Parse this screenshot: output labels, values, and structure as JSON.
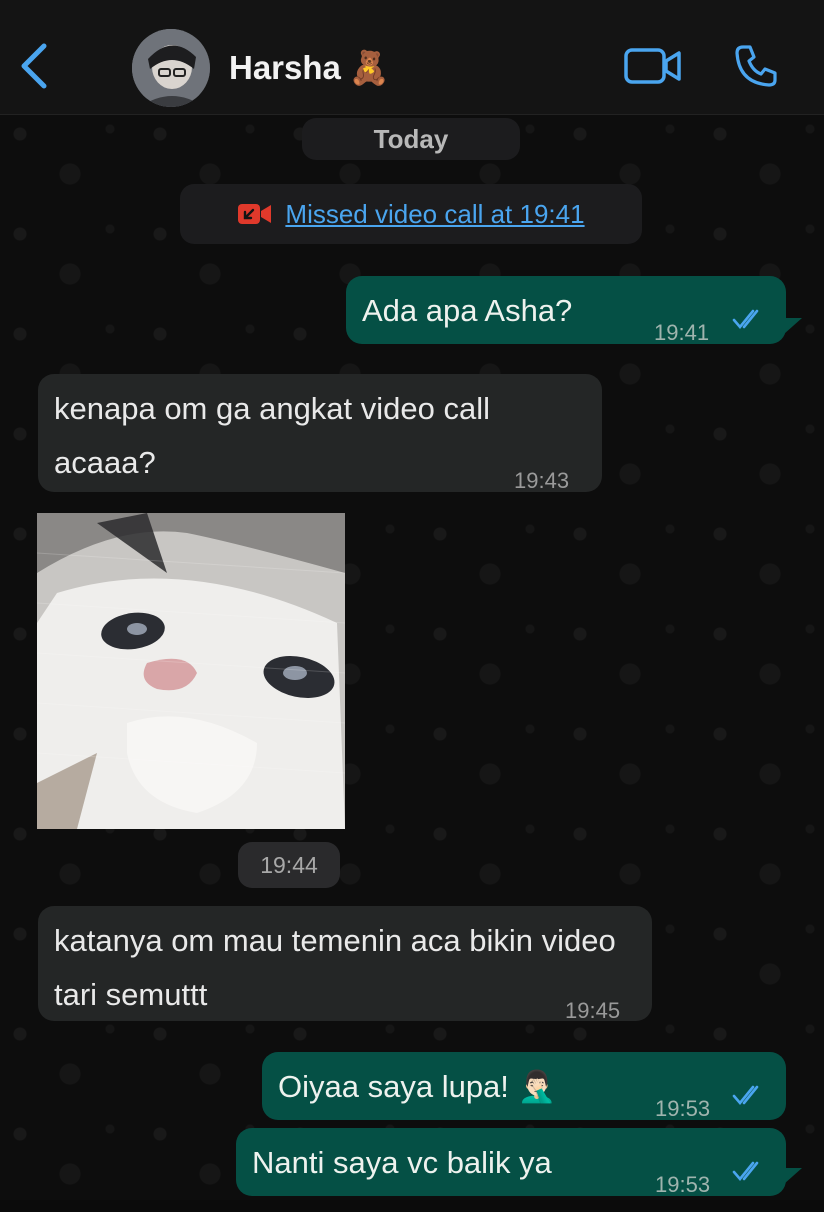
{
  "header": {
    "contact_name": "Harsha",
    "name_emoji": "🧸"
  },
  "date_divider": "Today",
  "missed_call": {
    "icon": "missed-video-call-icon",
    "text": "Missed video call at 19:41"
  },
  "messages": [
    {
      "direction": "outgoing",
      "text": "Ada apa Asha?",
      "time": "19:41",
      "status": "read"
    },
    {
      "direction": "incoming",
      "text": "kenapa om ga angkat video call acaaa?",
      "time": "19:43"
    },
    {
      "direction": "incoming",
      "type": "image",
      "image": "crying-cat-photo",
      "time": "19:44"
    },
    {
      "direction": "incoming",
      "text": "katanya om mau temenin aca bikin video tari semuttt",
      "time": "19:45"
    },
    {
      "direction": "outgoing",
      "text": "Oiyaa saya lupa! 🤦🏻‍♂️",
      "time": "19:53",
      "status": "read"
    },
    {
      "direction": "outgoing",
      "text": "Nanti saya vc balik ya",
      "time": "19:53",
      "status": "read"
    }
  ],
  "colors": {
    "accent": "#4aa5ef",
    "outgoing_bubble": "#055045",
    "incoming_bubble": "#242626",
    "missed_call_red": "#e0392b"
  }
}
